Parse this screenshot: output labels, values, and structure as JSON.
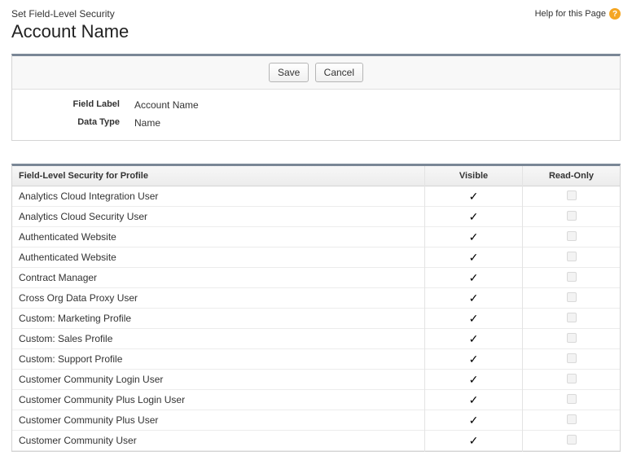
{
  "header": {
    "subtitle": "Set Field-Level Security",
    "title": "Account Name",
    "help_label": "Help for this Page",
    "help_icon_glyph": "?"
  },
  "buttons": {
    "save": "Save",
    "cancel": "Cancel"
  },
  "details": {
    "field_label_caption": "Field Label",
    "field_label_value": "Account Name",
    "data_type_caption": "Data Type",
    "data_type_value": "Name"
  },
  "table": {
    "header_profile": "Field-Level Security for Profile",
    "header_visible": "Visible",
    "header_readonly": "Read-Only"
  },
  "rows": [
    {
      "profile": "Analytics Cloud Integration User",
      "visible": true,
      "readonly": false
    },
    {
      "profile": "Analytics Cloud Security User",
      "visible": true,
      "readonly": false
    },
    {
      "profile": "Authenticated Website",
      "visible": true,
      "readonly": false
    },
    {
      "profile": "Authenticated Website",
      "visible": true,
      "readonly": false
    },
    {
      "profile": "Contract Manager",
      "visible": true,
      "readonly": false
    },
    {
      "profile": "Cross Org Data Proxy User",
      "visible": true,
      "readonly": false
    },
    {
      "profile": "Custom: Marketing Profile",
      "visible": true,
      "readonly": false
    },
    {
      "profile": "Custom: Sales Profile",
      "visible": true,
      "readonly": false
    },
    {
      "profile": "Custom: Support Profile",
      "visible": true,
      "readonly": false
    },
    {
      "profile": "Customer Community Login User",
      "visible": true,
      "readonly": false
    },
    {
      "profile": "Customer Community Plus Login User",
      "visible": true,
      "readonly": false
    },
    {
      "profile": "Customer Community Plus User",
      "visible": true,
      "readonly": false
    },
    {
      "profile": "Customer Community User",
      "visible": true,
      "readonly": false
    }
  ]
}
